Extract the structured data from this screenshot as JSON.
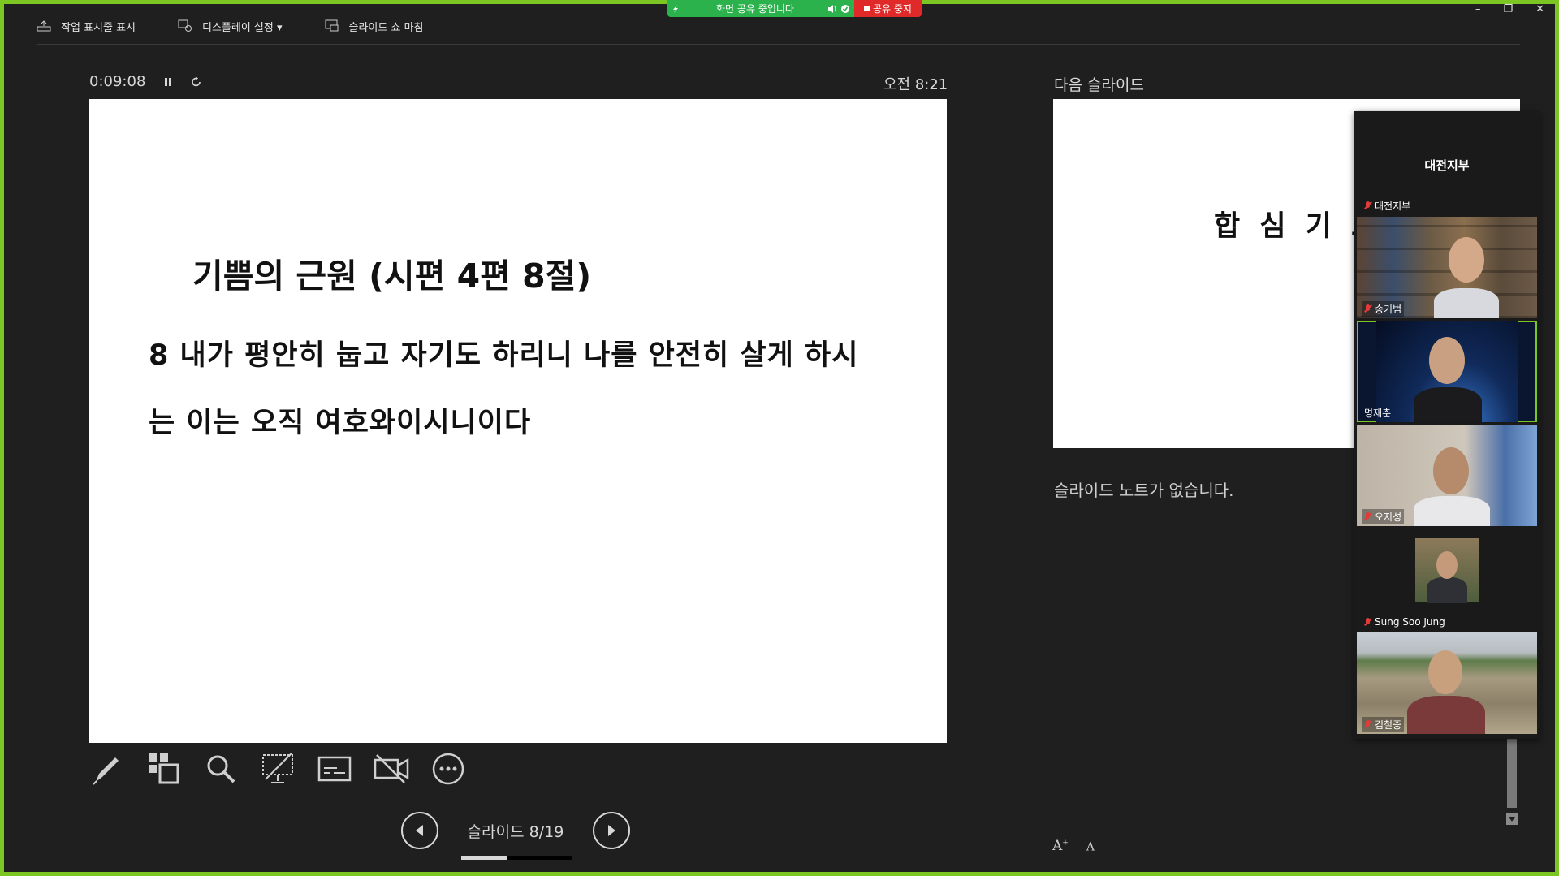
{
  "toolbar": {
    "taskbar_label": "작업 표시줄 표시",
    "display_label": "디스플레이 설정 ▾",
    "end_label": "슬라이드 쇼 마침"
  },
  "share_banner": {
    "status": "화면 공유 중입니다",
    "stop": "공유 중지"
  },
  "presenter": {
    "elapsed": "0:09:08",
    "clock": "오전 8:21",
    "slide_title": "기쁨의 근원 (시편 4편 8절)",
    "slide_line1": "8   내가 평안히 눕고 자기도 하리니 나를 안전히 살게 하시",
    "slide_line2": "는 이는 오직 여호와이시니이다",
    "nav_label": "슬라이드 8/19",
    "progress": 0.42
  },
  "next": {
    "label": "다음 슬라이드",
    "slide_text": "합 심 기 도",
    "notes": "슬라이드 노트가 없습니다."
  },
  "zoom": {
    "title": "대전지부",
    "participants": [
      {
        "name": "대전지부"
      },
      {
        "name": "송기범"
      },
      {
        "name": "명재춘"
      },
      {
        "name": "오지성"
      },
      {
        "name": "Sung Soo Jung"
      },
      {
        "name": "김철중"
      }
    ]
  },
  "colors": {
    "border": "#7cc624",
    "share_green": "#2bb24c",
    "share_red": "#e02a2a",
    "bg": "#1f1f1f"
  }
}
